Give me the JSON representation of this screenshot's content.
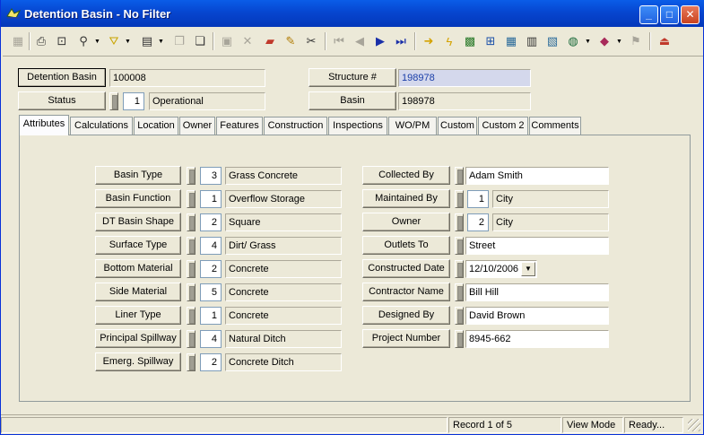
{
  "window": {
    "title": "Detention Basin - No Filter"
  },
  "caption_buttons": {
    "minimize": "_",
    "maximize": "□",
    "close": "✕"
  },
  "header": {
    "detention_basin_label": "Detention Basin",
    "detention_basin_value": "100008",
    "status_label": "Status",
    "status_code": "1",
    "status_value": "Operational",
    "structure_label": "Structure #",
    "structure_value": "198978",
    "basin_label": "Basin",
    "basin_value": "198978"
  },
  "tabs": [
    "Attributes",
    "Calculations",
    "Location",
    "Owner",
    "Features",
    "Construction",
    "Inspections",
    "WO/PM",
    "Custom",
    "Custom 2",
    "Comments"
  ],
  "left_fields": [
    {
      "label": "Basin Type",
      "code": "3",
      "value": "Grass Concrete"
    },
    {
      "label": "Basin Function",
      "code": "1",
      "value": "Overflow Storage"
    },
    {
      "label": "DT Basin Shape",
      "code": "2",
      "value": "Square"
    },
    {
      "label": "Surface Type",
      "code": "4",
      "value": "Dirt/ Grass"
    },
    {
      "label": "Bottom Material",
      "code": "2",
      "value": "Concrete"
    },
    {
      "label": "Side Material",
      "code": "5",
      "value": "Concrete"
    },
    {
      "label": "Liner Type",
      "code": "1",
      "value": "Concrete"
    },
    {
      "label": "Principal Spillway",
      "code": "4",
      "value": "Natural Ditch"
    },
    {
      "label": "Emerg. Spillway",
      "code": "2",
      "value": "Concrete Ditch"
    }
  ],
  "right_fields": {
    "collected_by": {
      "label": "Collected By",
      "value": "Adam Smith"
    },
    "maintained_by": {
      "label": "Maintained By",
      "code": "1",
      "value": "City"
    },
    "owner": {
      "label": "Owner",
      "code": "2",
      "value": "City"
    },
    "outlets_to": {
      "label": "Outlets To",
      "value": "Street"
    },
    "constructed_date": {
      "label": "Constructed Date",
      "value": "12/10/2006"
    },
    "contractor_name": {
      "label": "Contractor Name",
      "value": "Bill Hill"
    },
    "designed_by": {
      "label": "Designed By",
      "value": "David Brown"
    },
    "project_number": {
      "label": "Project Number",
      "value": "8945-662"
    }
  },
  "statusbar": {
    "record": "Record 1 of 5",
    "mode": "View Mode",
    "state": "Ready..."
  },
  "toolbar_icons": [
    "save-icon",
    "print-icon",
    "print-preview-icon",
    "binoculars-icon",
    "filter-icon",
    "report-icon",
    "copy-icon",
    "paste-icon",
    "delete-icon",
    "cancel-icon",
    "attach-icon",
    "edit-icon",
    "cut-icon",
    "first-record-icon",
    "previous-record-icon",
    "next-record-icon",
    "last-record-icon",
    "goto-icon",
    "lightning-icon",
    "map-icon",
    "tree-icon",
    "grid-icon",
    "calculator-icon",
    "chart-icon",
    "globe-icon",
    "book-icon",
    "flag-icon",
    "exit-icon"
  ],
  "colors": {
    "titlebar": "#0646d0",
    "face": "#ece9d8",
    "highlight_field": "#d4d8ec"
  }
}
